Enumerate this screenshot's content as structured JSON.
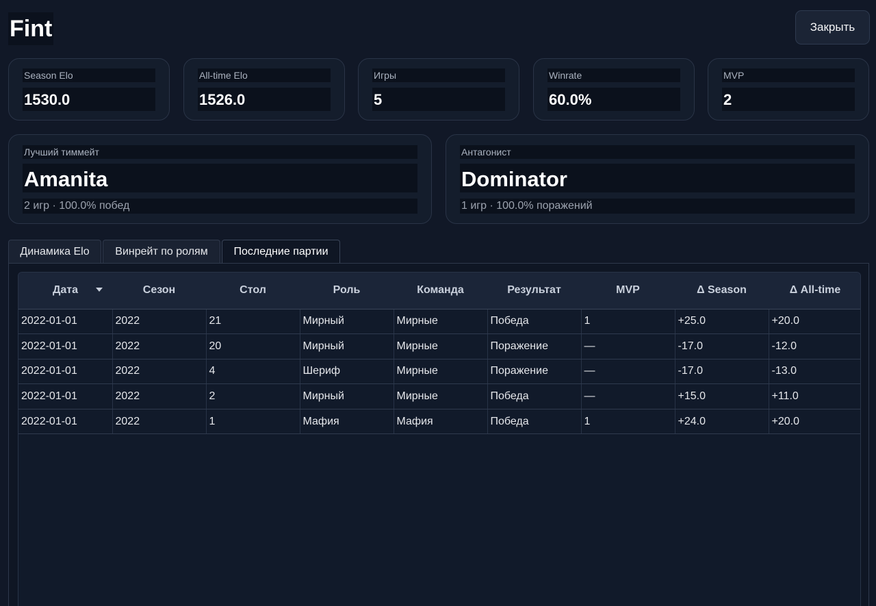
{
  "header": {
    "title": "Fint",
    "close_label": "Закрыть"
  },
  "stats": [
    {
      "label": "Season Elo",
      "value": "1530.0"
    },
    {
      "label": "All-time Elo",
      "value": "1526.0"
    },
    {
      "label": "Игры",
      "value": "5"
    },
    {
      "label": "Winrate",
      "value": "60.0%"
    },
    {
      "label": "MVP",
      "value": "2"
    }
  ],
  "teammate": {
    "label": "Лучший тиммейт",
    "name": "Amanita",
    "sub": "2 игр · 100.0% побед"
  },
  "antagonist": {
    "label": "Антагонист",
    "name": "Dominator",
    "sub": "1 игр · 100.0% поражений"
  },
  "tabs": [
    {
      "label": "Динамика Elo"
    },
    {
      "label": "Винрейт по ролям"
    },
    {
      "label": "Последние партии"
    }
  ],
  "table": {
    "columns": [
      "Дата",
      "Сезон",
      "Стол",
      "Роль",
      "Команда",
      "Результат",
      "MVP",
      "Δ Season",
      "Δ All-time"
    ],
    "rows": [
      [
        "2022-01-01",
        "2022",
        "21",
        "Мирный",
        "Мирные",
        "Победа",
        "1",
        "+25.0",
        "+20.0"
      ],
      [
        "2022-01-01",
        "2022",
        "20",
        "Мирный",
        "Мирные",
        "Поражение",
        "—",
        "-17.0",
        "-12.0"
      ],
      [
        "2022-01-01",
        "2022",
        "4",
        "Шериф",
        "Мирные",
        "Поражение",
        "—",
        "-17.0",
        "-13.0"
      ],
      [
        "2022-01-01",
        "2022",
        "2",
        "Мирный",
        "Мирные",
        "Победа",
        "—",
        "+15.0",
        "+11.0"
      ],
      [
        "2022-01-01",
        "2022",
        "1",
        "Мафия",
        "Мафия",
        "Победа",
        "1",
        "+24.0",
        "+20.0"
      ]
    ]
  }
}
